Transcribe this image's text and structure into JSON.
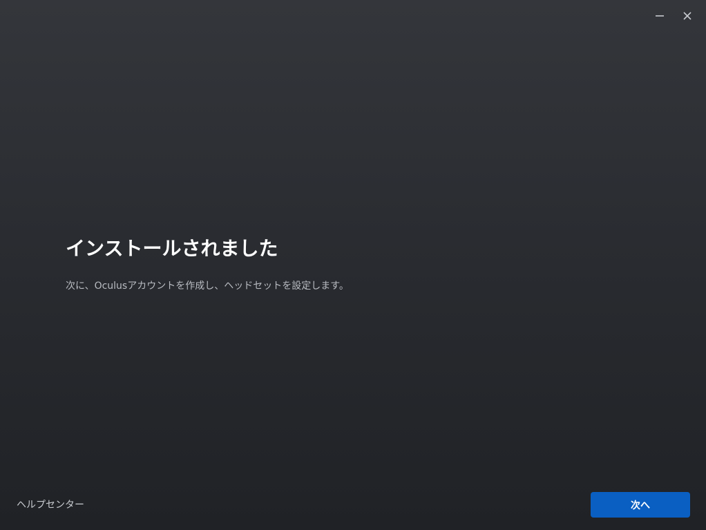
{
  "window": {
    "minimize_icon": "minimize-icon",
    "close_icon": "close-icon"
  },
  "main": {
    "title": "インストールされました",
    "subtitle": "次に、Oculusアカウントを作成し、ヘッドセットを設定します。"
  },
  "footer": {
    "help_label": "ヘルプセンター",
    "next_label": "次へ"
  },
  "colors": {
    "accent": "#0a5fc2",
    "background_top": "#34363b",
    "background_bottom": "#202226"
  }
}
